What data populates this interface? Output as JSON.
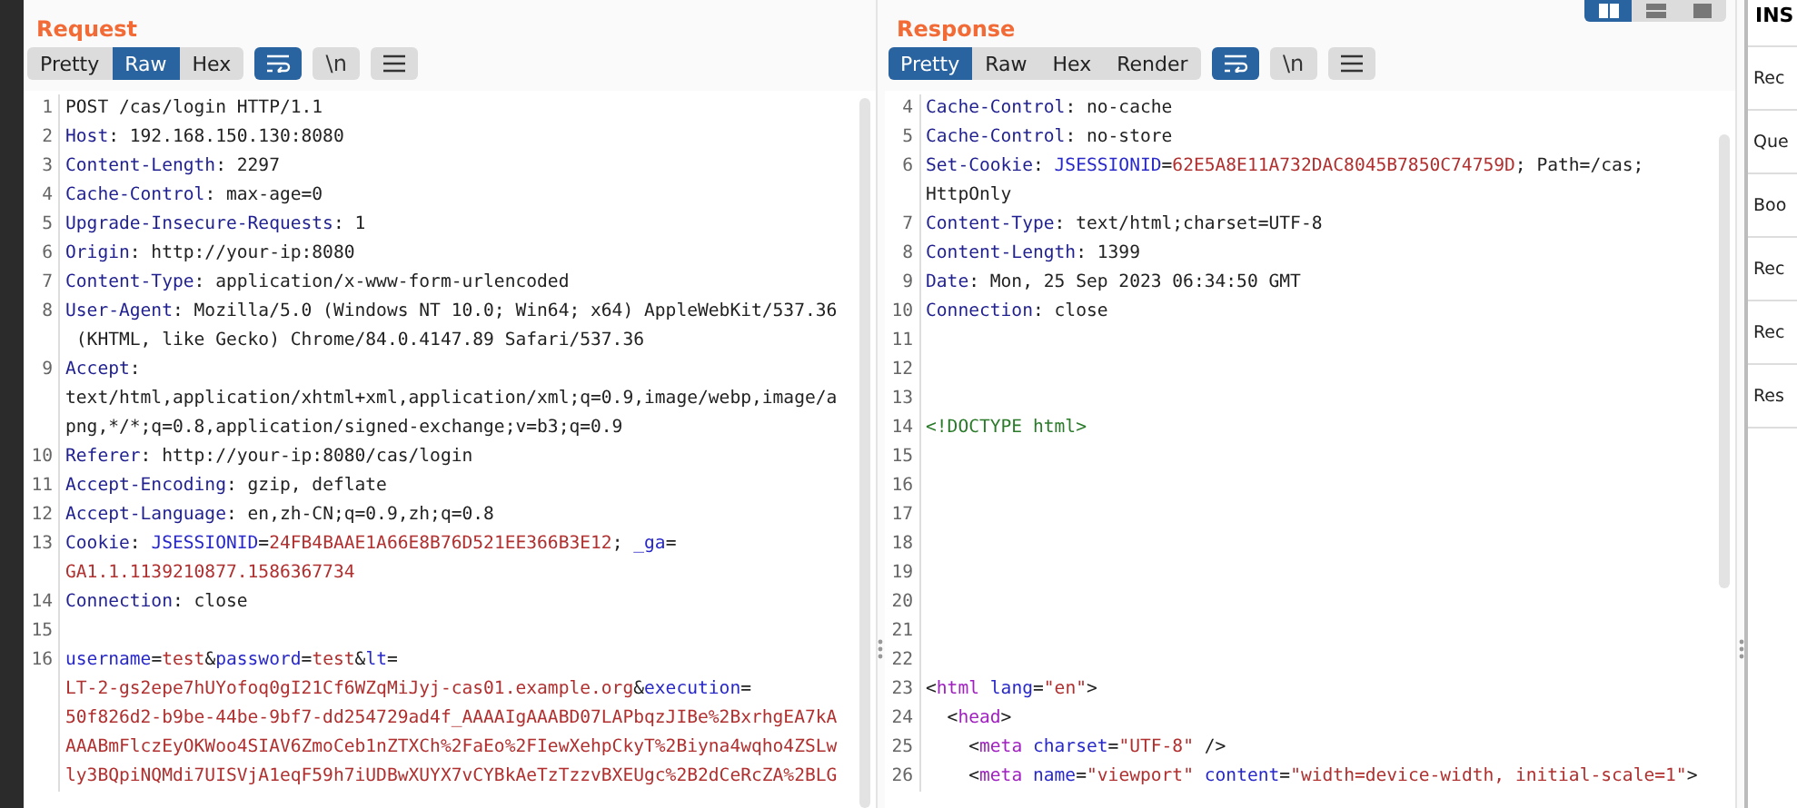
{
  "layout_buttons": [
    {
      "kind": "columns",
      "selected": true
    },
    {
      "kind": "rows",
      "selected": false
    },
    {
      "kind": "single",
      "selected": false
    }
  ],
  "panels": [
    {
      "title": "Request",
      "views": [
        {
          "label": "Pretty",
          "selected": false
        },
        {
          "label": "Raw",
          "selected": true
        },
        {
          "label": "Hex",
          "selected": false
        }
      ],
      "toggles": [
        {
          "kind": "wrap",
          "on": true
        },
        {
          "kind": "newline",
          "label": "\\n",
          "on": false
        },
        {
          "kind": "menu",
          "on": false
        }
      ],
      "lines": [
        {
          "number": "1",
          "rows": [
            {
              "tokens": [
                {
                  "kind": "plain",
                  "text": "POST /cas/login HTTP/1.1"
                }
              ]
            }
          ]
        },
        {
          "number": "2",
          "rows": [
            {
              "tokens": [
                {
                  "kind": "name",
                  "text": "Host"
                },
                {
                  "kind": "plain",
                  "text": ": 192.168.150.130:8080"
                }
              ]
            }
          ]
        },
        {
          "number": "3",
          "rows": [
            {
              "tokens": [
                {
                  "kind": "name",
                  "text": "Content-Length"
                },
                {
                  "kind": "plain",
                  "text": ": 2297"
                }
              ]
            }
          ]
        },
        {
          "number": "4",
          "rows": [
            {
              "tokens": [
                {
                  "kind": "name",
                  "text": "Cache-Control"
                },
                {
                  "kind": "plain",
                  "text": ": max-age=0"
                }
              ]
            }
          ]
        },
        {
          "number": "5",
          "rows": [
            {
              "tokens": [
                {
                  "kind": "name",
                  "text": "Upgrade-Insecure-Requests"
                },
                {
                  "kind": "plain",
                  "text": ": 1"
                }
              ]
            }
          ]
        },
        {
          "number": "6",
          "rows": [
            {
              "tokens": [
                {
                  "kind": "name",
                  "text": "Origin"
                },
                {
                  "kind": "plain",
                  "text": ": http://your-ip:8080"
                }
              ]
            }
          ]
        },
        {
          "number": "7",
          "rows": [
            {
              "tokens": [
                {
                  "kind": "name",
                  "text": "Content-Type"
                },
                {
                  "kind": "plain",
                  "text": ": application/x-www-form-urlencoded"
                }
              ]
            }
          ]
        },
        {
          "number": "8",
          "rows": [
            {
              "tokens": [
                {
                  "kind": "name",
                  "text": "User-Agent"
                },
                {
                  "kind": "plain",
                  "text": ": Mozilla/5.0 (Windows NT 10.0; Win64; x64) AppleWebKit/537.36"
                }
              ]
            },
            {
              "tokens": [
                {
                  "kind": "plain",
                  "text": " (KHTML, like Gecko) Chrome/84.0.4147.89 Safari/537.36"
                }
              ]
            }
          ]
        },
        {
          "number": "9",
          "rows": [
            {
              "tokens": [
                {
                  "kind": "name",
                  "text": "Accept"
                },
                {
                  "kind": "plain",
                  "text": ":"
                }
              ]
            },
            {
              "tokens": [
                {
                  "kind": "plain",
                  "text": "text/html,application/xhtml+xml,application/xml;q=0.9,image/webp,image/a"
                }
              ]
            },
            {
              "tokens": [
                {
                  "kind": "plain",
                  "text": "png,*/*;q=0.8,application/signed-exchange;v=b3;q=0.9"
                }
              ]
            }
          ]
        },
        {
          "number": "10",
          "rows": [
            {
              "tokens": [
                {
                  "kind": "name",
                  "text": "Referer"
                },
                {
                  "kind": "plain",
                  "text": ": http://your-ip:8080/cas/login"
                }
              ]
            }
          ]
        },
        {
          "number": "11",
          "rows": [
            {
              "tokens": [
                {
                  "kind": "name",
                  "text": "Accept-Encoding"
                },
                {
                  "kind": "plain",
                  "text": ": gzip, deflate"
                }
              ]
            }
          ]
        },
        {
          "number": "12",
          "rows": [
            {
              "tokens": [
                {
                  "kind": "name",
                  "text": "Accept-Language"
                },
                {
                  "kind": "plain",
                  "text": ": en,zh-CN;q=0.9,zh;q=0.8"
                }
              ]
            }
          ]
        },
        {
          "number": "13",
          "rows": [
            {
              "tokens": [
                {
                  "kind": "name",
                  "text": "Cookie"
                },
                {
                  "kind": "plain",
                  "text": ": "
                },
                {
                  "kind": "param",
                  "text": "JSESSIONID"
                },
                {
                  "kind": "plain",
                  "text": "="
                },
                {
                  "kind": "value",
                  "text": "24FB4BAAE1A66E8B76D521EE366B3E12"
                },
                {
                  "kind": "plain",
                  "text": "; "
                },
                {
                  "kind": "param",
                  "text": "_ga"
                },
                {
                  "kind": "plain",
                  "text": "="
                }
              ]
            },
            {
              "tokens": [
                {
                  "kind": "value",
                  "text": "GA1.1.1139210877.1586367734"
                }
              ]
            }
          ]
        },
        {
          "number": "14",
          "rows": [
            {
              "tokens": [
                {
                  "kind": "name",
                  "text": "Connection"
                },
                {
                  "kind": "plain",
                  "text": ": close"
                }
              ]
            }
          ]
        },
        {
          "number": "15"
        },
        {
          "number": "16",
          "rows": [
            {
              "tokens": [
                {
                  "kind": "param",
                  "text": "username"
                },
                {
                  "kind": "plain",
                  "text": "="
                },
                {
                  "kind": "value",
                  "text": "test"
                },
                {
                  "kind": "plain",
                  "text": "&"
                },
                {
                  "kind": "param",
                  "text": "password"
                },
                {
                  "kind": "plain",
                  "text": "="
                },
                {
                  "kind": "value",
                  "text": "test"
                },
                {
                  "kind": "plain",
                  "text": "&"
                },
                {
                  "kind": "param",
                  "text": "lt"
                },
                {
                  "kind": "plain",
                  "text": "="
                }
              ]
            },
            {
              "tokens": [
                {
                  "kind": "value",
                  "text": "LT-2-gs2epe7hUYofoq0gI21Cf6WZqMiJyj-cas01.example.org"
                },
                {
                  "kind": "plain",
                  "text": "&"
                },
                {
                  "kind": "param",
                  "text": "execution"
                },
                {
                  "kind": "plain",
                  "text": "="
                }
              ]
            },
            {
              "tokens": [
                {
                  "kind": "value",
                  "text": "50f826d2-b9be-44be-9bf7-dd254729ad4f_AAAAIgAAABD07LAPbqzJIBe%2BxrhgEA7kA"
                }
              ]
            },
            {
              "tokens": [
                {
                  "kind": "value",
                  "text": "AAABmFlczEyOKWoo4SIAV6ZmoCeb1nZTXCh%2FaEo%2FIewXehpCkyT%2Biyna4wqho4ZSLw"
                }
              ]
            },
            {
              "tokens": [
                {
                  "kind": "value",
                  "text": "ly3BQpiNQMdi7UISVjA1eqF59h7iUDBwXUYX7vCYBkAeTzTzzvBXEUgc%2B2dCeRcZA%2BLG"
                }
              ]
            }
          ]
        }
      ]
    },
    {
      "title": "Response",
      "views": [
        {
          "label": "Pretty",
          "selected": true
        },
        {
          "label": "Raw",
          "selected": false
        },
        {
          "label": "Hex",
          "selected": false
        },
        {
          "label": "Render",
          "selected": false
        }
      ],
      "toggles": [
        {
          "kind": "wrap",
          "on": true
        },
        {
          "kind": "newline",
          "label": "\\n",
          "on": false
        },
        {
          "kind": "menu",
          "on": false
        }
      ],
      "lines": [
        {
          "number": "4",
          "rows": [
            {
              "tokens": [
                {
                  "kind": "name",
                  "text": "Cache-Control"
                },
                {
                  "kind": "plain",
                  "text": ": no-cache"
                }
              ]
            }
          ]
        },
        {
          "number": "5",
          "rows": [
            {
              "tokens": [
                {
                  "kind": "name",
                  "text": "Cache-Control"
                },
                {
                  "kind": "plain",
                  "text": ": no-store"
                }
              ]
            }
          ]
        },
        {
          "number": "6",
          "rows": [
            {
              "tokens": [
                {
                  "kind": "name",
                  "text": "Set-Cookie"
                },
                {
                  "kind": "plain",
                  "text": ": "
                },
                {
                  "kind": "param",
                  "text": "JSESSIONID"
                },
                {
                  "kind": "plain",
                  "text": "="
                },
                {
                  "kind": "value",
                  "text": "62E5A8E11A732DAC8045B7850C74759D"
                },
                {
                  "kind": "plain",
                  "text": "; Path=/cas;"
                }
              ]
            },
            {
              "tokens": [
                {
                  "kind": "plain",
                  "text": "HttpOnly"
                }
              ]
            }
          ]
        },
        {
          "number": "7",
          "rows": [
            {
              "tokens": [
                {
                  "kind": "name",
                  "text": "Content-Type"
                },
                {
                  "kind": "plain",
                  "text": ": text/html;charset=UTF-8"
                }
              ]
            }
          ]
        },
        {
          "number": "8",
          "rows": [
            {
              "tokens": [
                {
                  "kind": "name",
                  "text": "Content-Length"
                },
                {
                  "kind": "plain",
                  "text": ": 1399"
                }
              ]
            }
          ]
        },
        {
          "number": "9",
          "rows": [
            {
              "tokens": [
                {
                  "kind": "name",
                  "text": "Date"
                },
                {
                  "kind": "plain",
                  "text": ": Mon, 25 Sep 2023 06:34:50 GMT"
                }
              ]
            }
          ]
        },
        {
          "number": "10",
          "rows": [
            {
              "tokens": [
                {
                  "kind": "name",
                  "text": "Connection"
                },
                {
                  "kind": "plain",
                  "text": ": close"
                }
              ]
            }
          ]
        },
        {
          "number": "11"
        },
        {
          "number": "12"
        },
        {
          "number": "13"
        },
        {
          "number": "14",
          "rows": [
            {
              "tokens": [
                {
                  "kind": "doctype",
                  "text": "<!DOCTYPE html>"
                }
              ]
            }
          ]
        },
        {
          "number": "15"
        },
        {
          "number": "16"
        },
        {
          "number": "17"
        },
        {
          "number": "18"
        },
        {
          "number": "19"
        },
        {
          "number": "20"
        },
        {
          "number": "21"
        },
        {
          "number": "22"
        },
        {
          "number": "23",
          "rows": [
            {
              "tokens": [
                {
                  "kind": "plain",
                  "text": "<"
                },
                {
                  "kind": "tag",
                  "text": "html"
                },
                {
                  "kind": "attr",
                  "text": " lang"
                },
                {
                  "kind": "plain",
                  "text": "="
                },
                {
                  "kind": "string",
                  "text": "\"en\""
                },
                {
                  "kind": "plain",
                  "text": ">"
                }
              ]
            }
          ]
        },
        {
          "number": "24",
          "rows": [
            {
              "tokens": [
                {
                  "kind": "plain",
                  "text": "  <"
                },
                {
                  "kind": "tag",
                  "text": "head"
                },
                {
                  "kind": "plain",
                  "text": ">"
                }
              ]
            }
          ]
        },
        {
          "number": "25",
          "rows": [
            {
              "tokens": [
                {
                  "kind": "plain",
                  "text": "    <"
                },
                {
                  "kind": "tag",
                  "text": "meta"
                },
                {
                  "kind": "attr",
                  "text": " charset"
                },
                {
                  "kind": "plain",
                  "text": "="
                },
                {
                  "kind": "string",
                  "text": "\"UTF-8\""
                },
                {
                  "kind": "plain",
                  "text": " />"
                }
              ]
            }
          ]
        },
        {
          "number": "26",
          "rows": [
            {
              "tokens": [
                {
                  "kind": "plain",
                  "text": "    <"
                },
                {
                  "kind": "tag",
                  "text": "meta"
                },
                {
                  "kind": "attr",
                  "text": " name"
                },
                {
                  "kind": "plain",
                  "text": "="
                },
                {
                  "kind": "string",
                  "text": "\"viewport\""
                },
                {
                  "kind": "attr",
                  "text": " content"
                },
                {
                  "kind": "plain",
                  "text": "="
                },
                {
                  "kind": "string",
                  "text": "\"width=device-width, initial-scale=1\""
                },
                {
                  "kind": "plain",
                  "text": ">"
                }
              ]
            }
          ]
        }
      ]
    }
  ],
  "inspector": {
    "title": "INS",
    "items": [
      "Rec",
      "Que",
      "Boo",
      "Rec",
      "Rec",
      "Res"
    ]
  }
}
